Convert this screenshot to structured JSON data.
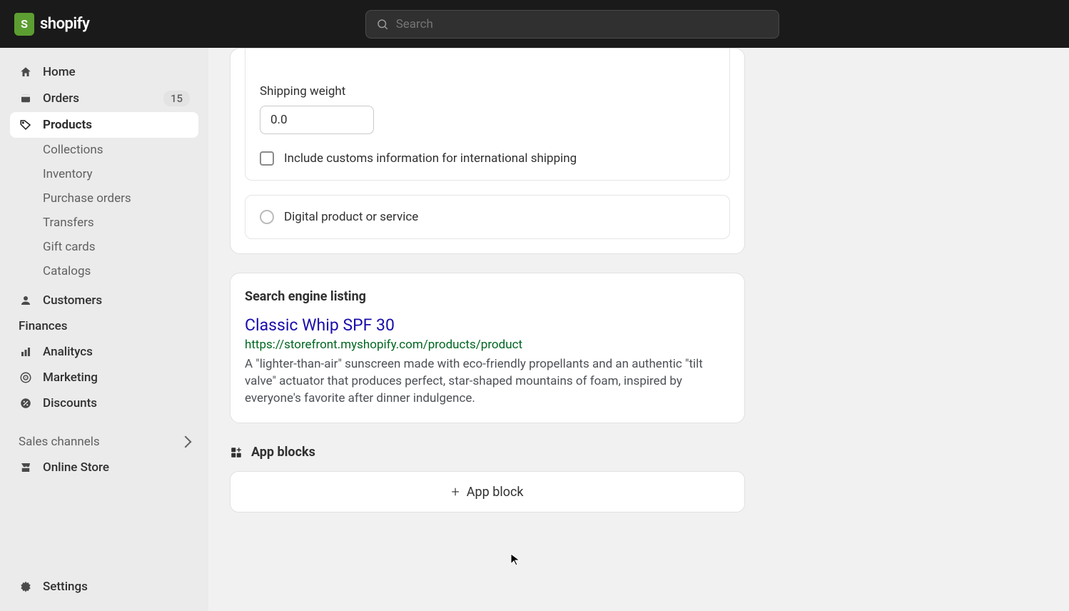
{
  "header": {
    "logo_text": "shopify",
    "search_placeholder": "Search"
  },
  "sidebar": {
    "home": "Home",
    "orders": {
      "label": "Orders",
      "badge": "15"
    },
    "products": "Products",
    "sub_products": {
      "collections": "Collections",
      "inventory": "Inventory",
      "purchase_orders": "Purchase orders",
      "transfers": "Transfers",
      "gift_cards": "Gift cards",
      "catalogs": "Catalogs"
    },
    "customers": "Customers",
    "finances": "Finances",
    "analytics": "Analitycs",
    "marketing": "Marketing",
    "discounts": "Discounts",
    "sales_channels": "Sales channels",
    "online_store": "Online Store",
    "settings": "Settings"
  },
  "shipping": {
    "weight_label": "Shipping weight",
    "weight_value": "0.0",
    "customs_label": "Include customs information for international shipping",
    "digital_label": "Digital product or service"
  },
  "seo": {
    "heading": "Search engine listing",
    "title": "Classic Whip SPF 30",
    "url": "https://storefront.myshopify.com/products/product",
    "description": "A \"lighter-than-air\" sunscreen made with eco-friendly propellants and an authentic \"tilt valve\" actuator that produces perfect, star-shaped mountains of foam, inspired by everyone's favorite after dinner indulgence."
  },
  "app_blocks": {
    "heading": "App blocks",
    "add_button": "App block"
  }
}
